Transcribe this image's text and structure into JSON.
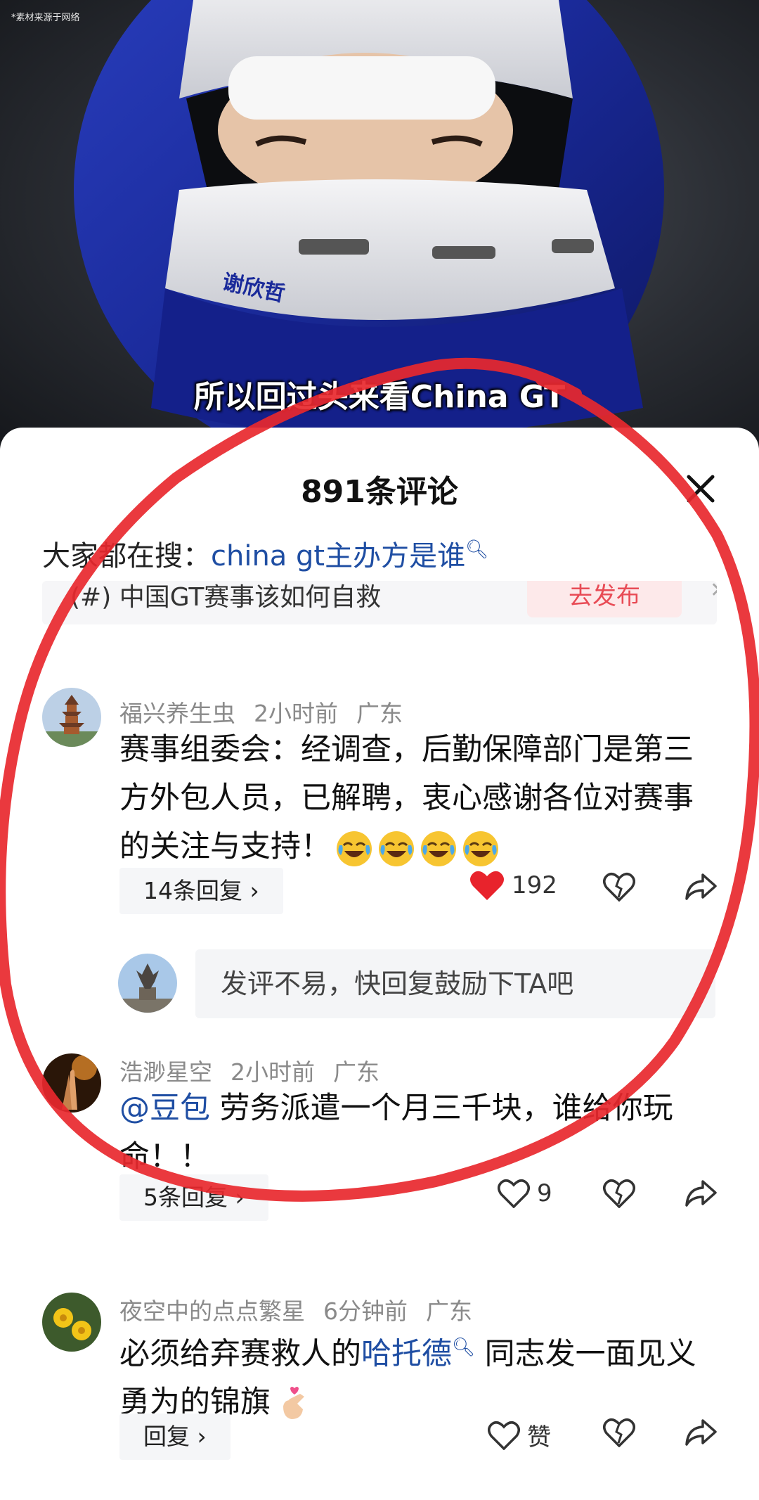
{
  "video": {
    "source_note": "*素材来源于网络",
    "subtitle": "所以回过头来看China GT",
    "helmet_name": "谢欣哲"
  },
  "sheet": {
    "title": "891条评论"
  },
  "hot_search": {
    "label": "大家都在搜：",
    "query": "china gt主办方是谁"
  },
  "topic_bar": {
    "topic": "中国GT赛事该如何自救",
    "publish_label": "去发布"
  },
  "comments": [
    {
      "username": "福兴养生虫",
      "time": "2小时前",
      "location": "广东",
      "text": "赛事组委会：经调查，后勤保障部门是第三方外包人员，已解聘，衷心感谢各位对赛事的关注与支持！",
      "replies_label": "14条回复 ›",
      "likes": "192",
      "liked": true
    },
    {
      "username": "浩渺星空",
      "time": "2小时前",
      "location": "广东",
      "mention": "@豆包",
      "text": " 劳务派遣一个月三千块，谁给你玩命！！",
      "replies_label": "5条回复 ›",
      "likes": "9",
      "liked": false
    },
    {
      "username": "夜空中的点点繁星",
      "time": "6分钟前",
      "location": "广东",
      "text_before": "必须给弃赛救人的",
      "link": "哈托德",
      "text_after": " 同志发一面见义勇为的锦旗",
      "replies_label": "回复 ›",
      "likes": "赞",
      "liked": false
    }
  ],
  "reply_input": {
    "placeholder": "发评不易，快回复鼓励下TA吧"
  },
  "colors": {
    "link_blue": "#1f4ea3",
    "like_red": "#e8232c",
    "annotation_red": "#e8282e"
  }
}
